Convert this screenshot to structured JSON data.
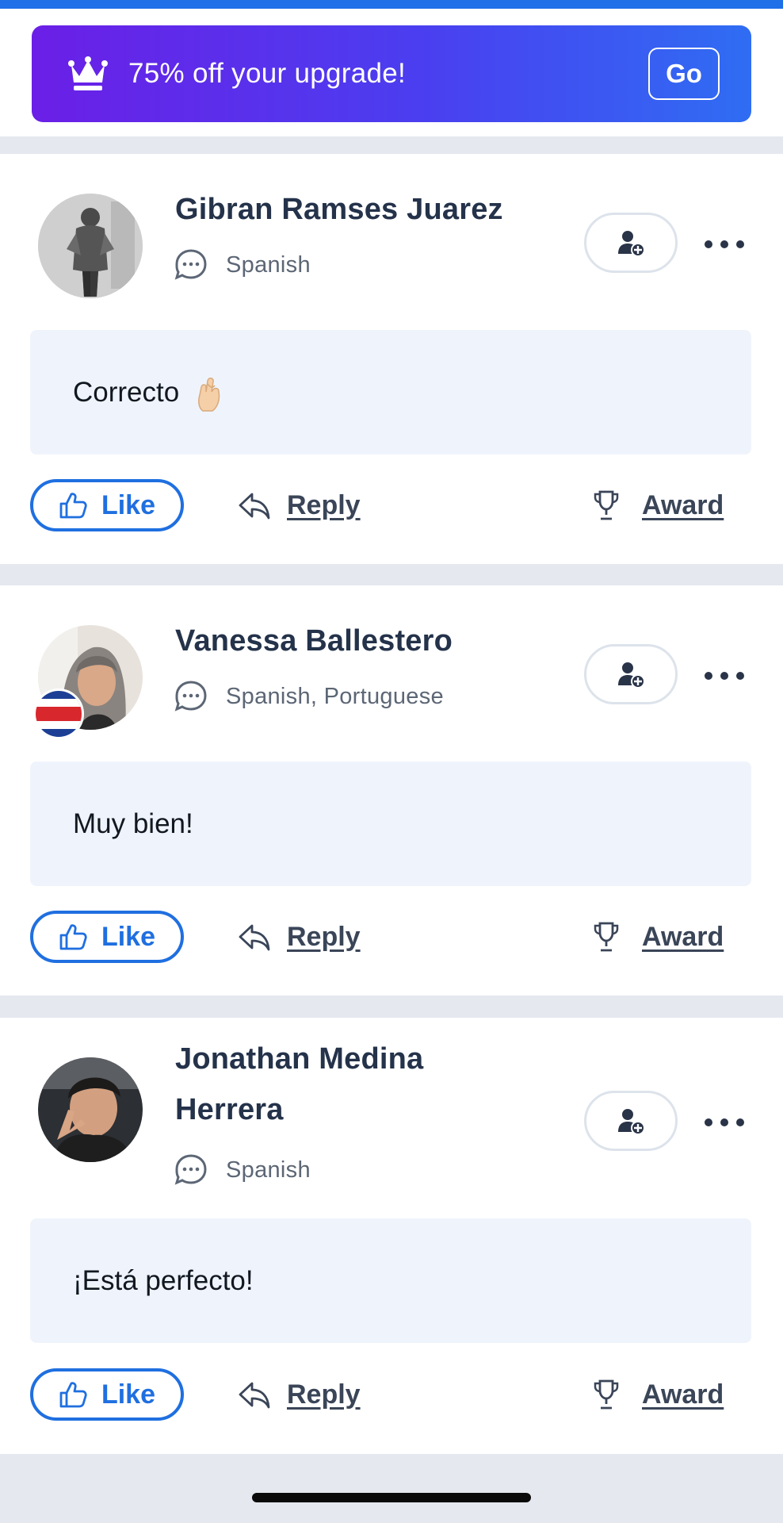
{
  "promo": {
    "text": "75% off your upgrade!",
    "button_label": "Go",
    "icon": "crown-icon"
  },
  "posts": [
    {
      "author": "Gibran Ramses Juarez",
      "languages": "Spanish",
      "message": "Correcto",
      "has_emoji": true,
      "emoji_icon": "crossed-fingers-emoji",
      "flag_icon": null,
      "like_label": "Like",
      "reply_label": "Reply",
      "award_label": "Award"
    },
    {
      "author": "Vanessa Ballestero",
      "languages": "Spanish, Portuguese",
      "message": "Muy bien!",
      "has_emoji": false,
      "flag_icon": "costa-rica-flag-icon",
      "like_label": "Like",
      "reply_label": "Reply",
      "award_label": "Award"
    },
    {
      "author_line1": "Jonathan Medina",
      "author_line2": "Herrera",
      "languages": "Spanish",
      "message": "¡Está perfecto!",
      "has_emoji": false,
      "flag_icon": null,
      "like_label": "Like",
      "reply_label": "Reply",
      "award_label": "Award"
    }
  ],
  "colors": {
    "accent_blue": "#1f6fe0",
    "promo_gradient_start": "#6b1fe6",
    "promo_gradient_end": "#2f6df3",
    "message_bubble": "#eff4fc",
    "separator": "#e5e8ee"
  }
}
